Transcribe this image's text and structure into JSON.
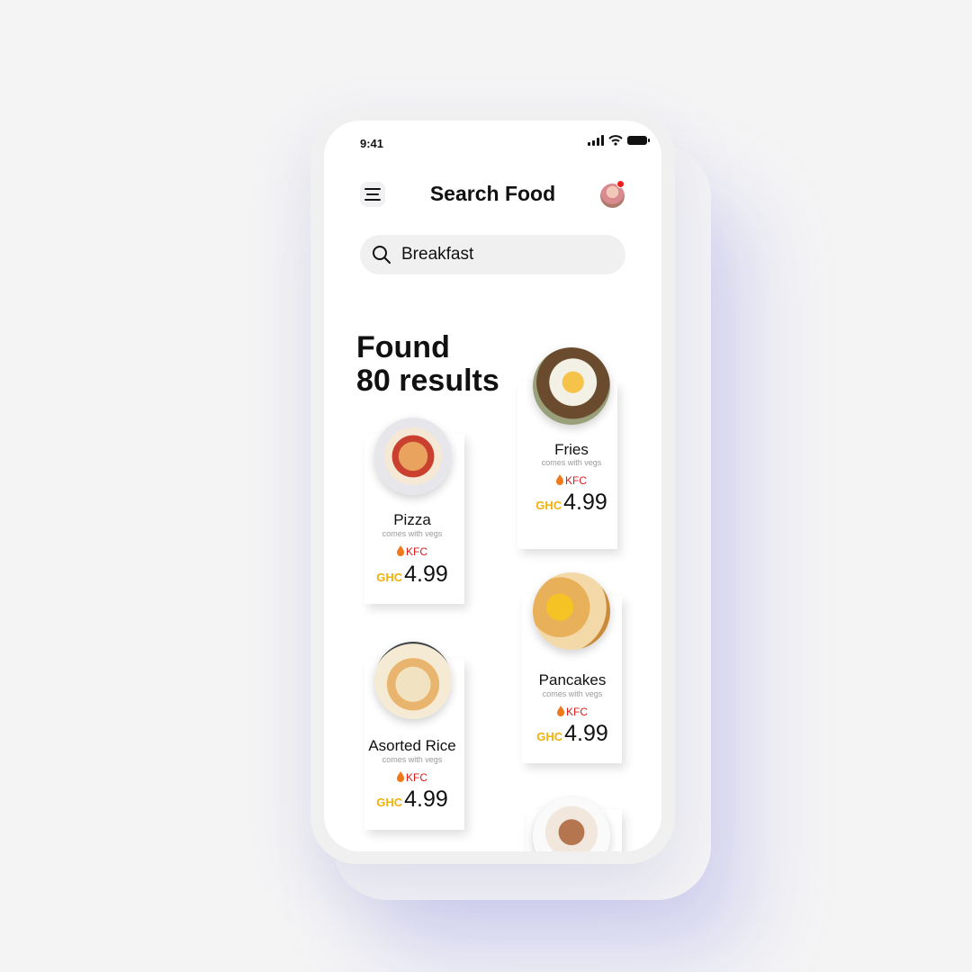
{
  "status": {
    "time": "9:41"
  },
  "header": {
    "title": "Search Food",
    "menu_icon": "menu-icon",
    "avatar": "avatar"
  },
  "search": {
    "value": "Breakfast",
    "icon": "search-icon"
  },
  "results": {
    "heading_line1": "Found",
    "heading_line2": "80 results"
  },
  "foods": [
    {
      "name": "Pizza",
      "subtitle": "comes with vegs",
      "shop": "KFC",
      "currency": "GHC",
      "price": "4.99",
      "image": "pizza-photo"
    },
    {
      "name": "Fries",
      "subtitle": "comes with vegs",
      "shop": "KFC",
      "currency": "GHC",
      "price": "4.99",
      "image": "fries-photo"
    },
    {
      "name": "Asorted Rice",
      "subtitle": "comes with vegs",
      "shop": "KFC",
      "currency": "GHC",
      "price": "4.99",
      "image": "rice-photo"
    },
    {
      "name": "Pancakes",
      "subtitle": "comes with vegs",
      "shop": "KFC",
      "currency": "GHC",
      "price": "4.99",
      "image": "pancakes-photo"
    },
    {
      "name": "",
      "subtitle": "",
      "shop": "",
      "currency": "",
      "price": "",
      "image": "coffee-photo"
    }
  ],
  "colors": {
    "accent": "#f2b10c",
    "shop": "#e01b1b",
    "background": "#f4f4f5"
  }
}
